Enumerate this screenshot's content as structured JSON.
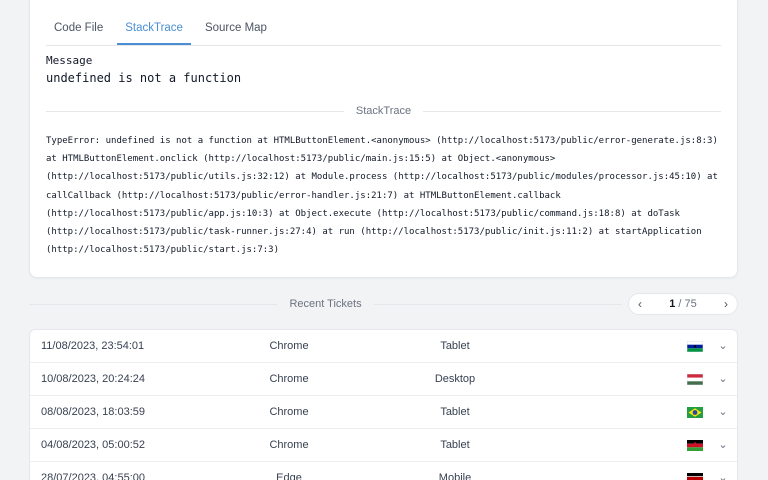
{
  "tabs": [
    {
      "label": "Code File",
      "active": false
    },
    {
      "label": "StackTrace",
      "active": true
    },
    {
      "label": "Source Map",
      "active": false
    }
  ],
  "message": {
    "label": "Message",
    "value": "undefined is not a function"
  },
  "stacktrace": {
    "divider_label": "StackTrace",
    "text": "TypeError: undefined is not a function at HTMLButtonElement.<anonymous> (http://localhost:5173/public/error-generate.js:8:3) at HTMLButtonElement.onclick (http://localhost:5173/public/main.js:15:5) at Object.<anonymous> (http://localhost:5173/public/utils.js:32:12) at Module.process (http://localhost:5173/public/modules/processor.js:45:10) at callCallback (http://localhost:5173/public/error-handler.js:21:7) at HTMLButtonElement.callback (http://localhost:5173/public/app.js:10:3) at Object.execute (http://localhost:5173/public/command.js:18:8) at doTask (http://localhost:5173/public/task-runner.js:27:4) at run (http://localhost:5173/public/init.js:11:2) at startApplication (http://localhost:5173/public/start.js:7:3)"
  },
  "recent_tickets": {
    "label": "Recent Tickets",
    "pager": {
      "current": "1",
      "total": "75",
      "separator": "/"
    },
    "rows": [
      {
        "datetime": "11/08/2023, 23:54:01",
        "browser": "Chrome",
        "device": "Tablet",
        "flag": "lesotho-flag-icon"
      },
      {
        "datetime": "10/08/2023, 20:24:24",
        "browser": "Chrome",
        "device": "Desktop",
        "flag": "hungary-flag-icon"
      },
      {
        "datetime": "08/08/2023, 18:03:59",
        "browser": "Chrome",
        "device": "Tablet",
        "flag": "brazil-flag-icon"
      },
      {
        "datetime": "04/08/2023, 05:00:52",
        "browser": "Chrome",
        "device": "Tablet",
        "flag": "malawi-flag-icon"
      },
      {
        "datetime": "28/07/2023, 04:55:00",
        "browser": "Edge",
        "device": "Mobile",
        "flag": "kenya-flag-icon"
      }
    ]
  },
  "colors": {
    "accent": "#4a8fd3",
    "background": "#f2f3f5",
    "card": "#ffffff",
    "border": "#e5e7eb"
  }
}
